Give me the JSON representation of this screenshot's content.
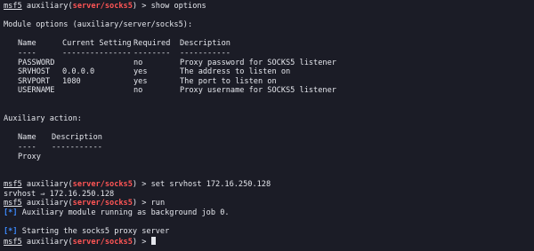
{
  "prompt": {
    "msf": "msf5",
    "module_prefix": "auxiliary(",
    "module_path": "server/socks5",
    "module_suffix": ") >"
  },
  "commands": {
    "show": "show options",
    "set": "set srvhost 172.16.250.128",
    "run": "run"
  },
  "module_options": {
    "heading": "Module options (auxiliary/server/socks5):",
    "columns": [
      "Name",
      "Current Setting",
      "Required",
      "Description"
    ],
    "underlines": [
      "----",
      "---------------",
      "--------",
      "-----------"
    ],
    "rows": [
      [
        "PASSWORD",
        "",
        "no",
        "Proxy password for SOCKS5 listener"
      ],
      [
        "SRVHOST",
        "0.0.0.0",
        "yes",
        "The address to listen on"
      ],
      [
        "SRVPORT",
        "1080",
        "yes",
        "The port to listen on"
      ],
      [
        "USERNAME",
        "",
        "no",
        "Proxy username for SOCKS5 listener"
      ]
    ]
  },
  "aux_action": {
    "heading": "Auxiliary action:",
    "columns": [
      "Name",
      "Description"
    ],
    "underlines": [
      "----",
      "-----------"
    ],
    "rows": [
      [
        "Proxy",
        ""
      ]
    ]
  },
  "output": {
    "set_result": "srvhost ⇒ 172.16.250.128",
    "status_marker": "[*]",
    "running": "Auxiliary module running as background job 0.",
    "starting": "Starting the socks5 proxy server"
  },
  "colors": {
    "background": "#1b1c26",
    "text": "#e4e6ec",
    "module": "#ff5555",
    "status": "#3d8bff"
  }
}
